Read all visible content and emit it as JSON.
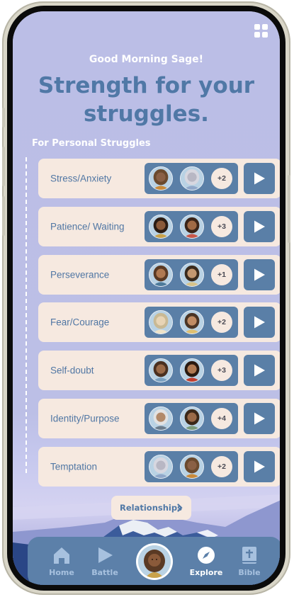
{
  "header": {
    "greeting": "Good Morning Sage!",
    "title": "Strength for your struggles.",
    "section_label": "For Personal Struggles"
  },
  "struggles": [
    {
      "label": "Stress/Anxiety",
      "more_count": "+2"
    },
    {
      "label": "Patience/ Waiting",
      "more_count": "+3"
    },
    {
      "label": "Perseverance",
      "more_count": "+1"
    },
    {
      "label": "Fear/Courage",
      "more_count": "+2"
    },
    {
      "label": "Self-doubt",
      "more_count": "+3"
    },
    {
      "label": "Identity/Purpose",
      "more_count": "+4"
    },
    {
      "label": "Temptation",
      "more_count": "+2"
    }
  ],
  "relationships_button": "Relationships",
  "nav": {
    "items": [
      {
        "label": "Home",
        "icon": "home-icon",
        "active": false
      },
      {
        "label": "Battle",
        "icon": "play-icon",
        "active": false
      },
      {
        "label": "",
        "icon": "profile-avatar",
        "active": false
      },
      {
        "label": "Explore",
        "icon": "compass-icon",
        "active": true
      },
      {
        "label": "Bible",
        "icon": "bible-icon",
        "active": false
      }
    ]
  },
  "colors": {
    "background": "#bcbfe6",
    "accent": "#5a7fa7",
    "card": "#f6e9e0",
    "title": "#5078a6"
  }
}
